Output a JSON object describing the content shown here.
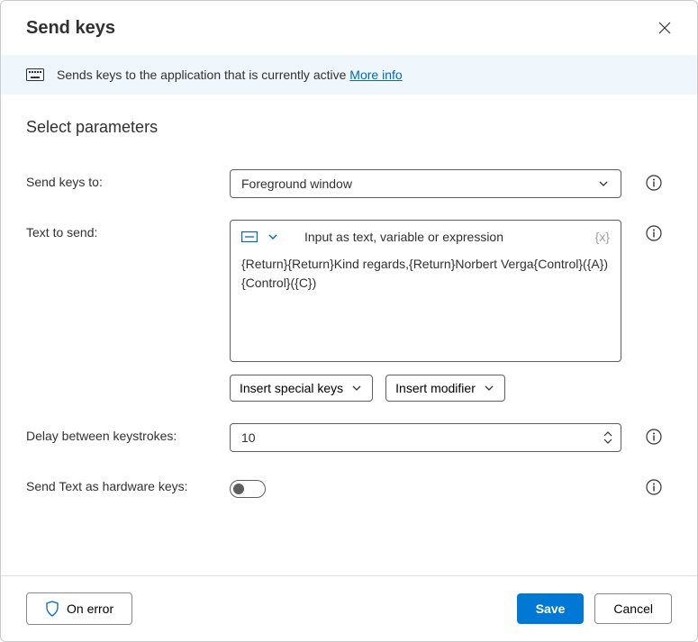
{
  "dialog": {
    "title": "Send keys",
    "info_banner": {
      "text": "Sends keys to the application that is currently active",
      "link_text": "More info"
    },
    "section_title": "Select parameters"
  },
  "fields": {
    "send_keys_to": {
      "label": "Send keys to:",
      "value": "Foreground window"
    },
    "text_to_send": {
      "label": "Text to send:",
      "placeholder": "Input as text, variable or expression",
      "var_hint": "{x}",
      "value": "{Return}{Return}Kind regards,{Return}Norbert Verga{Control}({A}){Control}({C})",
      "insert_special_keys": "Insert special keys",
      "insert_modifier": "Insert modifier"
    },
    "delay": {
      "label": "Delay between keystrokes:",
      "value": "10"
    },
    "hardware_keys": {
      "label": "Send Text as hardware keys:",
      "value": false
    }
  },
  "footer": {
    "on_error": "On error",
    "save": "Save",
    "cancel": "Cancel"
  }
}
